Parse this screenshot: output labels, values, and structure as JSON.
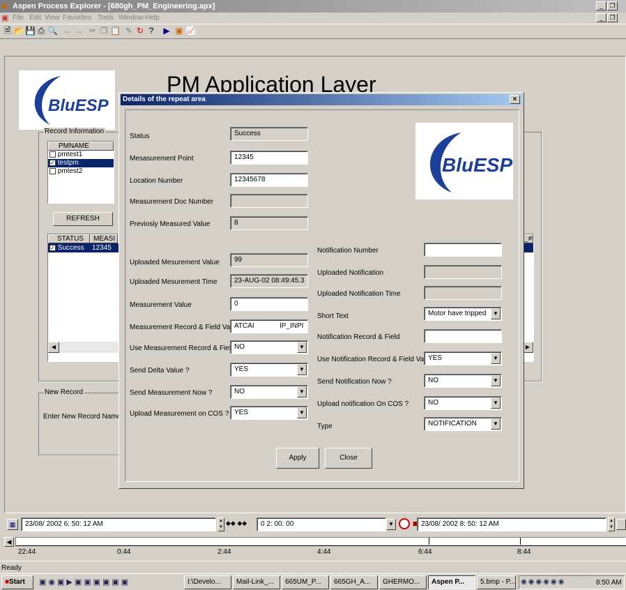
{
  "window": {
    "title": "Aspen Process Explorer - [680gh_PM_Engineering.apx]",
    "controls": [
      "_",
      "□",
      "×"
    ]
  },
  "menu": {
    "items": [
      "File",
      "Edit",
      "View",
      "Favorites",
      "Tools",
      "Window",
      "Help"
    ]
  },
  "logo": {
    "text": "BluESP"
  },
  "page_heading": "PM Application Layer",
  "record_info": {
    "legend": "Record Information",
    "list_header": "PMNAME",
    "items": [
      {
        "label": "pmtest1",
        "checked": false,
        "selected": false
      },
      {
        "label": "testpm",
        "checked": true,
        "selected": true
      },
      {
        "label": "pmtest2",
        "checked": false,
        "selected": false
      }
    ],
    "refresh_label": "REFRESH",
    "grid_headers": [
      "STATUS",
      "MEASI"
    ],
    "grid_row": {
      "status": "Success",
      "meas": "12345"
    },
    "right_header": "N_#"
  },
  "new_record": {
    "legend": "New Record",
    "label": "Enter New Record Name"
  },
  "dialog": {
    "title": "Details of the repeat area",
    "close": "×",
    "left": [
      {
        "label": "Status",
        "value": "Success",
        "kind": "ro"
      },
      {
        "label": "Mesasurement Point",
        "value": "12345",
        "kind": "edit"
      },
      {
        "label": "Location Number",
        "value": "12345678",
        "kind": "edit"
      },
      {
        "label": "Measurement Doc Number",
        "value": "",
        "kind": "ro"
      },
      {
        "label": "Previosly Measured Value",
        "value": "8",
        "kind": "ro"
      },
      {
        "label": "Uploaded Mesurement Value",
        "value": "99",
        "kind": "ro"
      },
      {
        "label": "Uploaded Mesurement Time",
        "value": "23-AUG-02 08:49:45.3",
        "kind": "ro"
      },
      {
        "label": "Measurement Value",
        "value": "0",
        "kind": "edit"
      },
      {
        "label": "Measurement Record & Field Value",
        "value": "ATCAI",
        "value2": "IP_INPI",
        "kind": "split"
      },
      {
        "label": "Use Measurement Record & Field ?",
        "value": "NO",
        "kind": "combo"
      },
      {
        "label": "Send Delta Value ?",
        "value": "YES",
        "kind": "combo"
      },
      {
        "label": "Send Measurement Now ?",
        "value": "NO",
        "kind": "combo"
      },
      {
        "label": "Upload Measurement on COS ?",
        "value": "YES",
        "kind": "combo"
      }
    ],
    "right": [
      {
        "label": "Notification Number",
        "value": "",
        "kind": "edit"
      },
      {
        "label": "Uploaded Notification",
        "value": "",
        "kind": "ro"
      },
      {
        "label": "Uploaded Notification Time",
        "value": "",
        "kind": "ro"
      },
      {
        "label": "Short Text",
        "value": "Motor have tripped",
        "kind": "combo"
      },
      {
        "label": "Notification Record & Field",
        "value": "",
        "kind": "edit"
      },
      {
        "label": "Use Notification Record & Field Value",
        "value": "YES",
        "kind": "combo"
      },
      {
        "label": "Send Notification Now ?",
        "value": "NO",
        "kind": "combo"
      },
      {
        "label": "Upload notification On COS ?",
        "value": "NO",
        "kind": "combo"
      },
      {
        "label": "Type",
        "value": "NOTIFICATION",
        "kind": "combo"
      }
    ],
    "apply_label": "Apply",
    "close_label": "Close"
  },
  "timebar": {
    "start": "23/08/ 2002   6: 50: 12 AM",
    "duration": "0 2: 00: 00",
    "end": "23/08/ 2002   8: 50: 12 AM",
    "ticks": [
      "22:44",
      "0:44",
      "2:44",
      "4:44",
      "6:44",
      "8:44"
    ]
  },
  "status": "Ready",
  "taskbar": {
    "start": "Start",
    "tasks": [
      "I:\\Develo...",
      "Mail-Link_...",
      "665UM_P...",
      "665GH_A...",
      "GHERMO...",
      "Aspen P...",
      "5.bmp - P..."
    ],
    "clock": "8:50 AM"
  },
  "colors": {
    "title_active": "#0a246a",
    "title_inactive": "#808080",
    "selection": "#0a246a",
    "logo_blue": "#1b3f9a",
    "face": "#d4d0c8"
  }
}
